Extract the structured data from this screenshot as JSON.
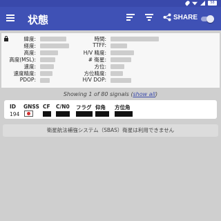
{
  "status_bar": {
    "icons": [
      "location-icon",
      "wifi-icon",
      "signal-icon",
      "battery-icon"
    ],
    "battery_level": "58"
  },
  "app_bar": {
    "title": "状態",
    "share_label": "SHARE",
    "icons": [
      "menu-icon",
      "sort-icon",
      "filter-icon",
      "share-icon",
      "toggle-switch"
    ],
    "colors": {
      "primary": "#3f51b5",
      "status_bar": "#3949ab"
    }
  },
  "location": {
    "latitude_label": "緯度:",
    "longitude_label": "経度:",
    "altitude_label": "高度:",
    "altitude_msl_label": "高度(MSL):",
    "speed_label": "速度:",
    "speed_accuracy_label": "速度精度:",
    "pdop_label": "PDOP:",
    "time_label": "時間:",
    "ttff_label": "TTFF:",
    "hv_accuracy_label": "H/V 精度:",
    "num_sats_label": "# 衛星:",
    "bearing_label": "方位:",
    "bearing_accuracy_label": "方位精度:",
    "hv_dop_label": "H/V DOP:"
  },
  "signals": {
    "showing_prefix": "Showing 1 of 80 signals (",
    "show_all": "show all",
    "showing_suffix": ")"
  },
  "table": {
    "headers": [
      "ID",
      "GNSS",
      "CF",
      "C/N0",
      "フラグ",
      "仰角",
      "方位角"
    ],
    "row": {
      "id": "194",
      "gnss_flag": "japan-flag-icon"
    }
  },
  "sbas_message": "衛星航法補強システム（SBAS）衛星は利用できません"
}
